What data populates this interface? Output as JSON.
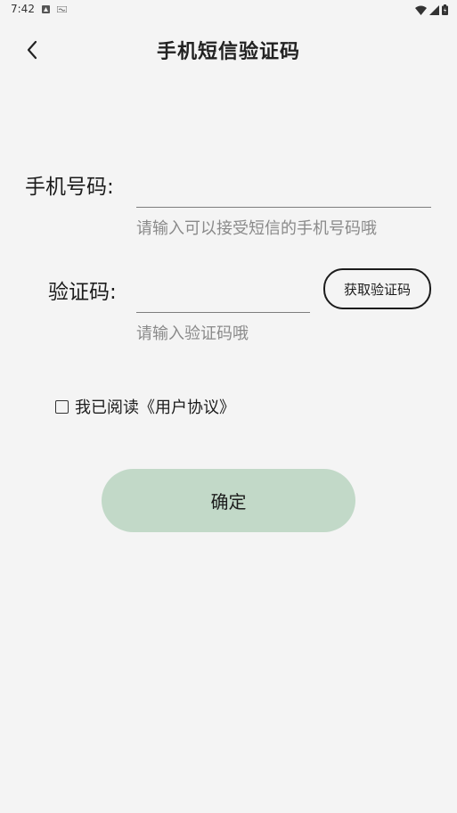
{
  "status_bar": {
    "time": "7:42"
  },
  "header": {
    "title": "手机短信验证码"
  },
  "form": {
    "phone_label": "手机号码:",
    "phone_value": "",
    "phone_hint": "请输入可以接受短信的手机号码哦",
    "code_label": "验证码:",
    "code_value": "",
    "code_hint": "请输入验证码哦",
    "get_code_label": "获取验证码"
  },
  "agreement": {
    "checked": false,
    "text": "我已阅读《用户协议》"
  },
  "confirm": {
    "label": "确定",
    "color": "#c2d9c8"
  }
}
